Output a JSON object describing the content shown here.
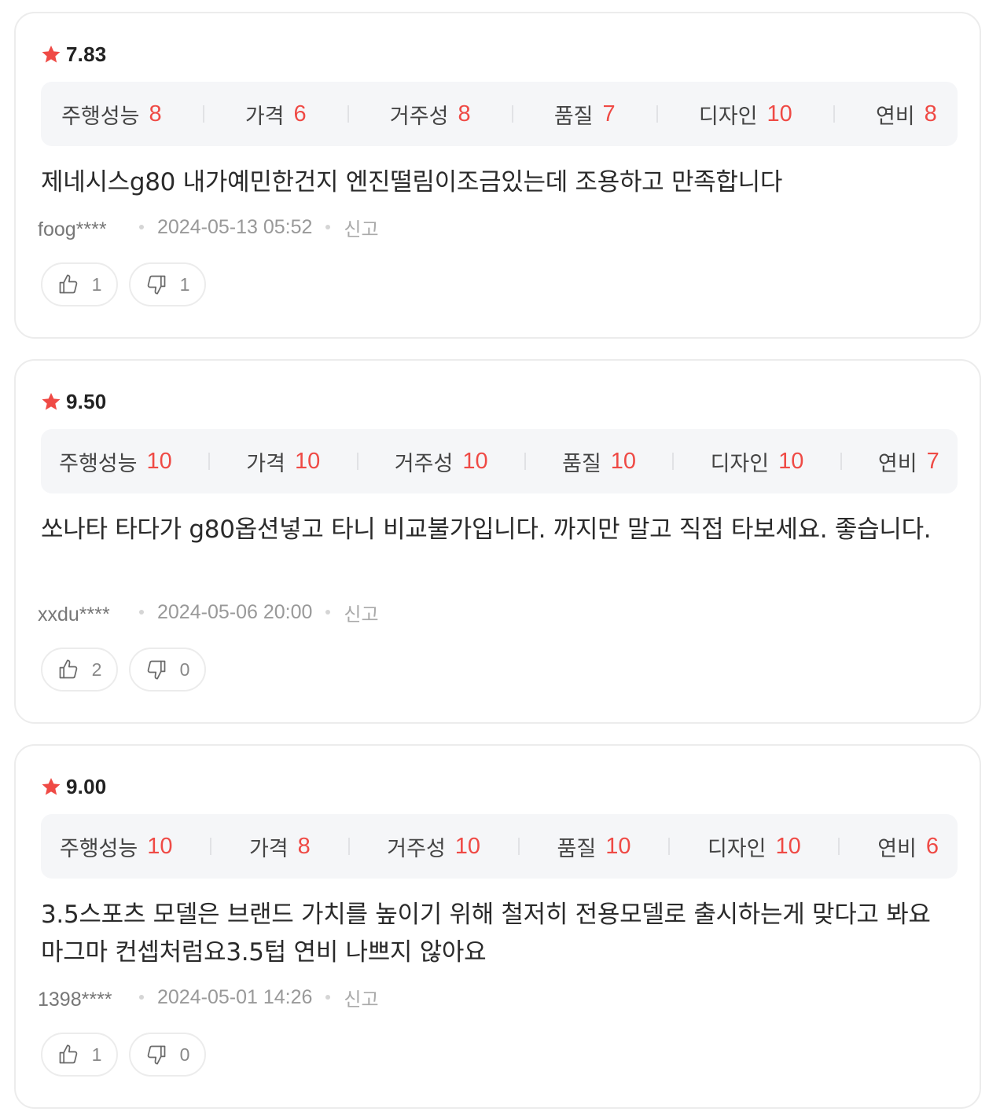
{
  "reviews": [
    {
      "rating": "7.83",
      "metrics": [
        {
          "label": "주행성능",
          "value": "8"
        },
        {
          "label": "가격",
          "value": "6"
        },
        {
          "label": "거주성",
          "value": "8"
        },
        {
          "label": "품질",
          "value": "7"
        },
        {
          "label": "디자인",
          "value": "10"
        },
        {
          "label": "연비",
          "value": "8"
        }
      ],
      "text": "제네시스g80 내가예민한건지 엔진떨림이조금있는데 조용하고 만족합니다",
      "author": "foog****",
      "date": "2024-05-13 05:52",
      "report_label": "신고",
      "likes": "1",
      "dislikes": "1"
    },
    {
      "rating": "9.50",
      "metrics": [
        {
          "label": "주행성능",
          "value": "10"
        },
        {
          "label": "가격",
          "value": "10"
        },
        {
          "label": "거주성",
          "value": "10"
        },
        {
          "label": "품질",
          "value": "10"
        },
        {
          "label": "디자인",
          "value": "10"
        },
        {
          "label": "연비",
          "value": "7"
        }
      ],
      "text": "쏘나타 타다가 g80옵션넣고 타니 비교불가입니다. 까지만 말고 직접 타보세요. 좋습니다.",
      "author": "xxdu****",
      "date": "2024-05-06 20:00",
      "report_label": "신고",
      "likes": "2",
      "dislikes": "0"
    },
    {
      "rating": "9.00",
      "metrics": [
        {
          "label": "주행성능",
          "value": "10"
        },
        {
          "label": "가격",
          "value": "8"
        },
        {
          "label": "거주성",
          "value": "10"
        },
        {
          "label": "품질",
          "value": "10"
        },
        {
          "label": "디자인",
          "value": "10"
        },
        {
          "label": "연비",
          "value": "6"
        }
      ],
      "text": "3.5스포츠 모델은 브랜드 가치를 높이기 위해 철저히 전용모델로 출시하는게 맞다고 봐요 마그마 컨셉처럼요3.5텁 연비 나쁘지 않아요",
      "author": "1398****",
      "date": "2024-05-01 14:26",
      "report_label": "신고",
      "likes": "1",
      "dislikes": "0"
    }
  ],
  "icons": {
    "rating": "star-icon",
    "like": "thumbs-up-icon",
    "dislike": "thumbs-down-icon"
  },
  "colors": {
    "accent": "#ef4a45",
    "metrics_background": "#f5f6f8",
    "border": "#ececec"
  }
}
